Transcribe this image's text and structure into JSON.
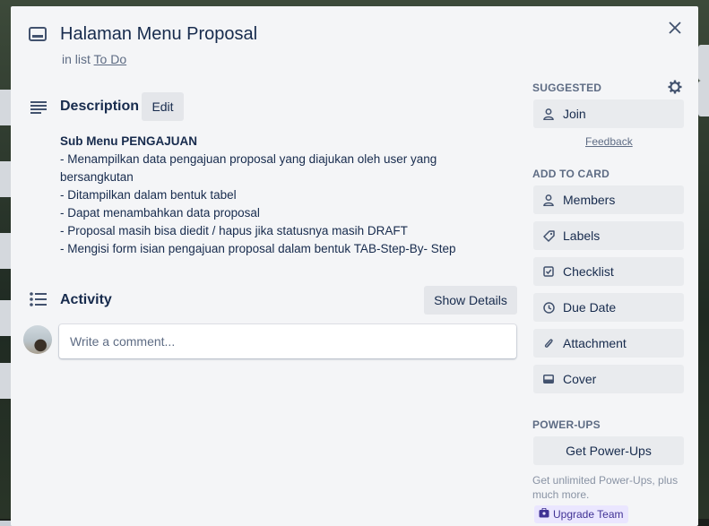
{
  "card": {
    "title": "Halaman Menu Proposal",
    "list_prefix": "in list",
    "list_name": "To Do"
  },
  "description": {
    "title": "Description",
    "edit_label": "Edit",
    "heading": "Sub Menu PENGAJUAN",
    "lines": [
      "- Menampilkan data pengajuan proposal yang diajukan oleh user yang bersangkutan",
      "- Ditampilkan dalam bentuk tabel",
      "- Dapat menambahkan data proposal",
      "- Proposal masih bisa diedit / hapus jika statusnya masih DRAFT",
      "- Mengisi form isian pengajuan proposal dalam bentuk TAB-Step-By- Step"
    ]
  },
  "activity": {
    "title": "Activity",
    "show_details_label": "Show Details",
    "comment_placeholder": "Write a comment..."
  },
  "sidebar": {
    "suggested_heading": "SUGGESTED",
    "join_label": "Join",
    "feedback_label": "Feedback",
    "add_heading": "ADD TO CARD",
    "add_items": [
      {
        "label": "Members",
        "icon": "person-icon"
      },
      {
        "label": "Labels",
        "icon": "tag-icon"
      },
      {
        "label": "Checklist",
        "icon": "checklist-icon"
      },
      {
        "label": "Due Date",
        "icon": "clock-icon"
      },
      {
        "label": "Attachment",
        "icon": "paperclip-icon"
      },
      {
        "label": "Cover",
        "icon": "cover-icon"
      }
    ],
    "powerups_heading": "POWER-UPS",
    "get_powerups_label": "Get Power-Ups",
    "powerups_desc": "Get unlimited Power-Ups, plus much more.",
    "upgrade_label": "Upgrade Team"
  },
  "colors": {
    "modal_bg": "#f4f5f7",
    "button_bg": "#e9ebee",
    "text": "#172b4d",
    "muted": "#5e6c84",
    "upgrade_bg": "#eae6ff",
    "upgrade_text": "#403294"
  }
}
